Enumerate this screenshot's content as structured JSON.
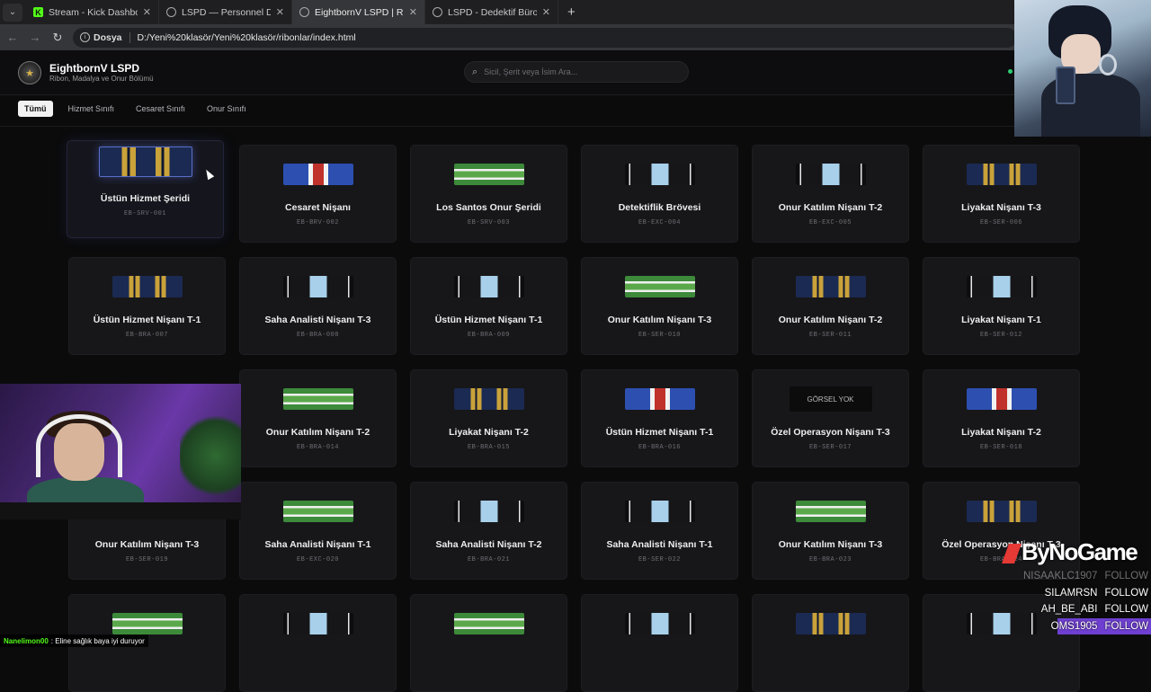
{
  "browser": {
    "tabs": [
      {
        "title": "Stream - Kick Dashboard",
        "icon": "kick-icon",
        "active": false
      },
      {
        "title": "LSPD — Personnel Database",
        "icon": "globe-icon",
        "active": false
      },
      {
        "title": "EightbornV LSPD | Ribon, Mada…",
        "icon": "globe-icon",
        "active": true
      },
      {
        "title": "LSPD - Dedektif Büro Yönetim P…",
        "icon": "globe-icon",
        "active": false
      }
    ],
    "scheme_label": "Dosya",
    "url": "D:/Yeni%20klasör/Yeni%20klasör/ribonlar/index.html"
  },
  "header": {
    "title": "EightbornV LSPD",
    "subtitle": "Ribon, Madalya ve Onur Bölümü",
    "search_placeholder": "Sicil, Şerit veya İsim Ara..."
  },
  "filters": [
    "Tümü",
    "Hizmet Sınıfı",
    "Cesaret Sınıfı",
    "Onur Sınıfı"
  ],
  "active_filter": "Tümü",
  "ribbons": [
    {
      "name": "Üstün Hizmet Şeridi",
      "code": "EB-SRV-001",
      "style": "navy-gold",
      "selected": true
    },
    {
      "name": "Cesaret Nişanı",
      "code": "EB-BRV-002",
      "style": "blue-red"
    },
    {
      "name": "Los Santos Onur Şeridi",
      "code": "EB-SRV-003",
      "style": "green-white"
    },
    {
      "name": "Detektiflik Brövesi",
      "code": "EB-EXC-004",
      "style": "black-lightblue"
    },
    {
      "name": "Onur Katılım Nişanı T-2",
      "code": "EB-EXC-005",
      "style": "black-lightblue"
    },
    {
      "name": "Liyakat Nişanı T-3",
      "code": "EB-SER-006",
      "style": "navy-gold"
    },
    {
      "name": "Üstün Hizmet Nişanı T-1",
      "code": "EB-BRA-007",
      "style": "navy-gold"
    },
    {
      "name": "Saha Analisti Nişanı T-3",
      "code": "EB-BRA-008",
      "style": "black-lightblue"
    },
    {
      "name": "Üstün Hizmet Nişanı T-1",
      "code": "EB-BRA-009",
      "style": "black-lightblue"
    },
    {
      "name": "Onur Katılım Nişanı T-3",
      "code": "EB-SER-010",
      "style": "green-white"
    },
    {
      "name": "Onur Katılım Nişanı T-2",
      "code": "EB-SER-011",
      "style": "navy-gold"
    },
    {
      "name": "Liyakat Nişanı T-1",
      "code": "EB-SER-012",
      "style": "black-lightblue"
    },
    {
      "name": "",
      "code": "",
      "style": "hidden"
    },
    {
      "name": "Onur Katılım Nişanı T-2",
      "code": "EB-BRA-014",
      "style": "green-white"
    },
    {
      "name": "Liyakat Nişanı T-2",
      "code": "EB-BRA-015",
      "style": "navy-gold"
    },
    {
      "name": "Üstün Hizmet Nişanı T-1",
      "code": "EB-BRA-016",
      "style": "blue-red"
    },
    {
      "name": "Özel Operasyon Nişanı T-3",
      "code": "EB-SER-017",
      "style": "empty",
      "placeholder": "GÖRSEL YOK"
    },
    {
      "name": "Liyakat Nişanı T-2",
      "code": "EB-SER-018",
      "style": "blue-red"
    },
    {
      "name": "Onur Katılım Nişanı T-3",
      "code": "EB-SER-019",
      "style": "hidden-ribbon"
    },
    {
      "name": "Saha Analisti Nişanı T-1",
      "code": "EB-EXC-020",
      "style": "green-white"
    },
    {
      "name": "Saha Analisti Nişanı T-2",
      "code": "EB-BRA-021",
      "style": "black-lightblue"
    },
    {
      "name": "Saha Analisti Nişanı T-1",
      "code": "EB-SER-022",
      "style": "black-lightblue"
    },
    {
      "name": "Onur Katılım Nişanı T-3",
      "code": "EB-BRA-023",
      "style": "green-white"
    },
    {
      "name": "Özel Operasyon Nişanı T-3",
      "code": "EB-BRA-024",
      "style": "navy-gold"
    },
    {
      "name": "",
      "code": "",
      "style": "green-white"
    },
    {
      "name": "",
      "code": "",
      "style": "black-lightblue"
    },
    {
      "name": "",
      "code": "",
      "style": "green-white"
    },
    {
      "name": "",
      "code": "",
      "style": "black-lightblue"
    },
    {
      "name": "",
      "code": "",
      "style": "navy-gold"
    },
    {
      "name": "",
      "code": "",
      "style": "black-lightblue"
    }
  ],
  "overlay": {
    "chat_user": "Nanelimon00",
    "chat_message": ": Eline sağlık baya iyi duruyor",
    "brand": "ByNoGame",
    "follows": [
      {
        "name": "NISAAKLC1907",
        "action": "FOLLOW",
        "faded": true
      },
      {
        "name": "SILAMRSN",
        "action": "FOLLOW"
      },
      {
        "name": "AH_BE_ABI",
        "action": "FOLLOW"
      },
      {
        "name": "OMS1905",
        "action": "FOLLOW",
        "highlight": true
      }
    ]
  },
  "colors": {
    "navy": "#1b2a52",
    "gold": "#c9a23a",
    "green": "#3d8a3a",
    "lightblue": "#a8d0ea",
    "red": "#c0312b",
    "blue": "#2c4fb0"
  }
}
